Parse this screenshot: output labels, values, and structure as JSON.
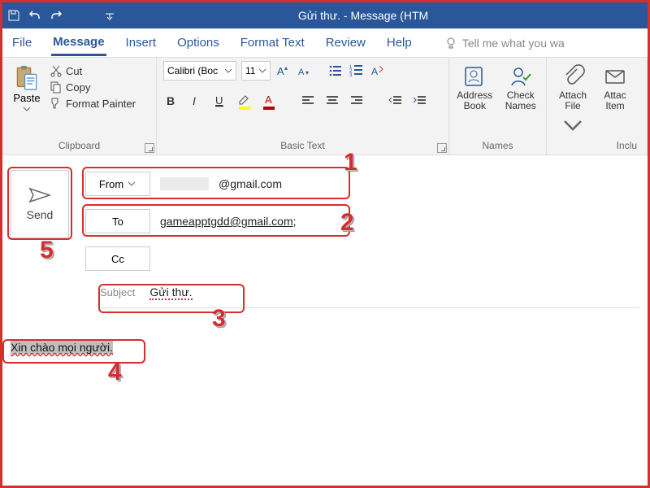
{
  "window": {
    "title": "Gửi thư.  -  Message (HTM"
  },
  "tabs": {
    "file": "File",
    "message": "Message",
    "insert": "Insert",
    "options": "Options",
    "formattext": "Format Text",
    "review": "Review",
    "help": "Help",
    "tellme": "Tell me what you wa"
  },
  "ribbon": {
    "clipboard": {
      "paste": "Paste",
      "cut": "Cut",
      "copy": "Copy",
      "formatpainter": "Format Painter",
      "label": "Clipboard"
    },
    "basictext": {
      "font_name": "Calibri (Boc",
      "font_size": "11",
      "label": "Basic Text"
    },
    "names": {
      "addressbook": "Address\nBook",
      "checknames": "Check\nNames",
      "label": "Names"
    },
    "include": {
      "attachfile": "Attach\nFile",
      "attachitem": "Attac\nItem",
      "label": "Inclu"
    }
  },
  "compose": {
    "send": "Send",
    "from_label": "From",
    "from_value": "@gmail.com",
    "to_label": "To",
    "to_value": "gameapptgdd@gmail.com;",
    "cc_label": "Cc",
    "cc_value": "",
    "subject_label": "Subject",
    "subject_value": "Gửi thư.",
    "body_text": "Xin chào mọi người.",
    "body_space": " "
  },
  "annotations": {
    "n1": "1",
    "n2": "2",
    "n3": "3",
    "n4": "4",
    "n5": "5"
  }
}
